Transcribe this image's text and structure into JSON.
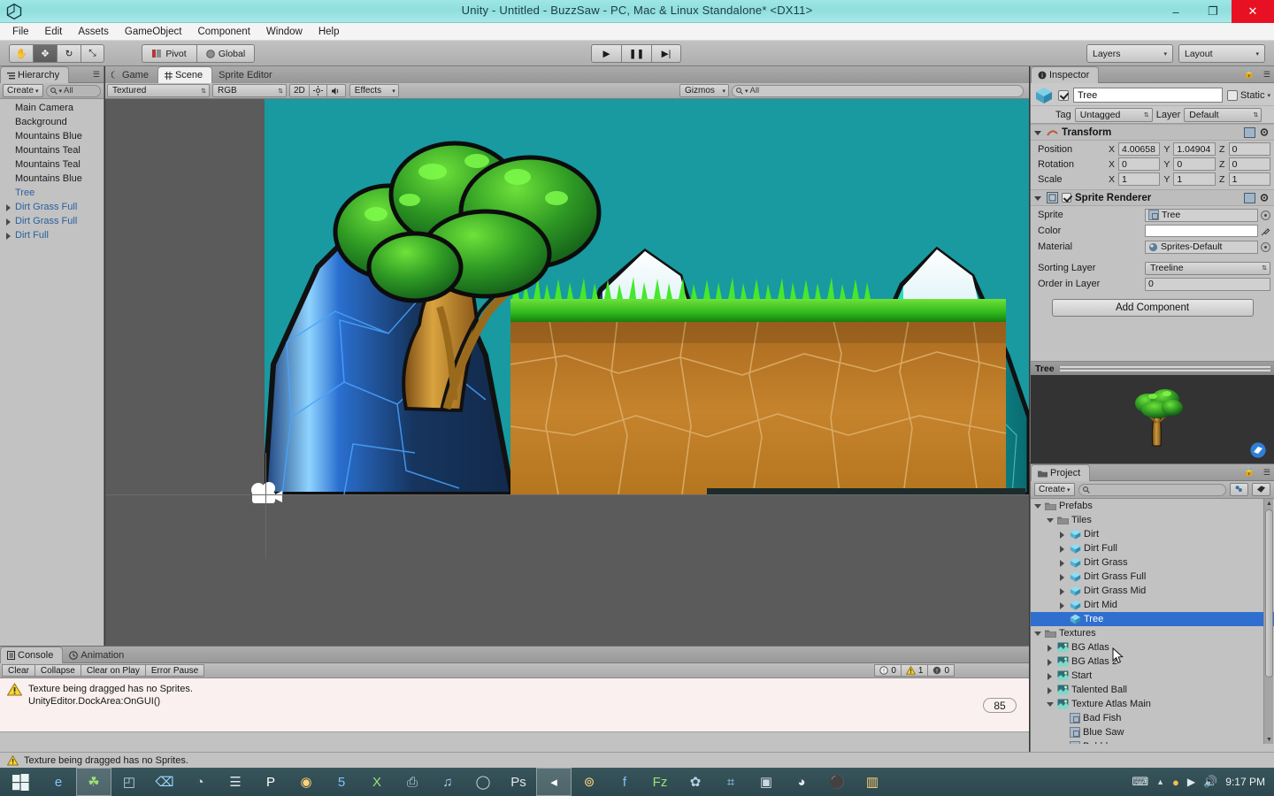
{
  "window": {
    "title": "Unity - Untitled - BuzzSaw - PC, Mac & Linux Standalone* <DX11>",
    "minimize": "–",
    "maximize": "❐",
    "close": "✕",
    "logo_icon": "unity-logo-icon"
  },
  "menubar": {
    "items": [
      "File",
      "Edit",
      "Assets",
      "GameObject",
      "Component",
      "Window",
      "Help"
    ]
  },
  "toolbar": {
    "tools": [
      {
        "name": "hand-tool",
        "glyph": "✋"
      },
      {
        "name": "move-tool",
        "glyph": "✥"
      },
      {
        "name": "rotate-tool",
        "glyph": "↻"
      },
      {
        "name": "scale-tool",
        "glyph": "⤡"
      }
    ],
    "pivot_label": "Pivot",
    "global_label": "Global",
    "play_glyph": "▶",
    "pause_glyph": "❚❚",
    "step_glyph": "▶|",
    "layers_label": "Layers",
    "layout_label": "Layout",
    "caret": "▾"
  },
  "hierarchy": {
    "tab_label": "Hierarchy",
    "create_label": "Create",
    "search_value": "All",
    "search_icon": "search-icon",
    "items": [
      {
        "label": "Main Camera",
        "expandable": false,
        "blue": false
      },
      {
        "label": "Background",
        "expandable": false,
        "blue": false
      },
      {
        "label": "Mountains Blue",
        "expandable": false,
        "blue": false
      },
      {
        "label": "Mountains Teal",
        "expandable": false,
        "blue": false
      },
      {
        "label": "Mountains Teal",
        "expandable": false,
        "blue": false
      },
      {
        "label": "Mountains Blue",
        "expandable": false,
        "blue": false
      },
      {
        "label": "Tree",
        "expandable": false,
        "blue": true
      },
      {
        "label": "Dirt Grass Full",
        "expandable": true,
        "blue": true
      },
      {
        "label": "Dirt Grass Full",
        "expandable": true,
        "blue": true
      },
      {
        "label": "Dirt Full",
        "expandable": true,
        "blue": true
      }
    ]
  },
  "scene": {
    "tabs": [
      {
        "label": "Game",
        "icon": "game-icon",
        "selected": false
      },
      {
        "label": "Scene",
        "icon": "scene-grid-icon",
        "selected": true
      },
      {
        "label": "Sprite Editor",
        "icon": "",
        "selected": false
      }
    ],
    "draw_mode": "Textured",
    "color_mode": "RGB",
    "mode_2d": "2D",
    "lighting_icon": "sun-icon",
    "audio_icon": "speaker-icon",
    "effects_label": "Effects",
    "gizmos_label": "Gizmos",
    "gizmo_search_value": "All",
    "camera_gizmo": "camera-gizmo-icon"
  },
  "inspector": {
    "tab_label": "Inspector",
    "lock_icon": "lock-icon",
    "menu_icon": "options-icon",
    "object_name": "Tree",
    "object_enabled": true,
    "static_label": "Static",
    "tag_label": "Tag",
    "tag_value": "Untagged",
    "layer_label": "Layer",
    "layer_value": "Default",
    "transform": {
      "title": "Transform",
      "rows": [
        {
          "label": "Position",
          "x": "4.00658",
          "y": "1.04904",
          "z": "0"
        },
        {
          "label": "Rotation",
          "x": "0",
          "y": "0",
          "z": "0"
        },
        {
          "label": "Scale",
          "x": "1",
          "y": "1",
          "z": "1"
        }
      ]
    },
    "sprite_renderer": {
      "title": "Sprite Renderer",
      "enabled": true,
      "sprite_label": "Sprite",
      "sprite_value": "Tree",
      "color_label": "Color",
      "color_value": "#FFFFFF",
      "material_label": "Material",
      "material_value": "Sprites-Default",
      "sorting_layer_label": "Sorting Layer",
      "sorting_layer_value": "Treeline",
      "order_in_layer_label": "Order in Layer",
      "order_in_layer_value": "0"
    },
    "add_component_label": "Add Component",
    "preview_title": "Tree",
    "preview_tag_icon": "tag-icon"
  },
  "project": {
    "tab_label": "Project",
    "create_label": "Create",
    "search_value": "",
    "search_icon": "search-icon",
    "favorite_icon": "add-favorite-icon",
    "label_icon": "label-icon",
    "items": [
      {
        "label": "Prefabs",
        "indent": 0,
        "arrow": "open",
        "icon": "folder",
        "selected": false
      },
      {
        "label": "Tiles",
        "indent": 1,
        "arrow": "open",
        "icon": "folder",
        "selected": false
      },
      {
        "label": "Dirt",
        "indent": 2,
        "arrow": "closed",
        "icon": "prefab",
        "selected": false
      },
      {
        "label": "Dirt Full",
        "indent": 2,
        "arrow": "closed",
        "icon": "prefab",
        "selected": false
      },
      {
        "label": "Dirt Grass",
        "indent": 2,
        "arrow": "closed",
        "icon": "prefab",
        "selected": false
      },
      {
        "label": "Dirt Grass Full",
        "indent": 2,
        "arrow": "closed",
        "icon": "prefab",
        "selected": false
      },
      {
        "label": "Dirt Grass Mid",
        "indent": 2,
        "arrow": "closed",
        "icon": "prefab",
        "selected": false
      },
      {
        "label": "Dirt Mid",
        "indent": 2,
        "arrow": "closed",
        "icon": "prefab",
        "selected": false
      },
      {
        "label": "Tree",
        "indent": 2,
        "arrow": "none",
        "icon": "prefab",
        "selected": true
      },
      {
        "label": "Textures",
        "indent": 0,
        "arrow": "open",
        "icon": "folder",
        "selected": false
      },
      {
        "label": "BG Atlas",
        "indent": 1,
        "arrow": "closed",
        "icon": "texture",
        "selected": false
      },
      {
        "label": "BG Atlas 2",
        "indent": 1,
        "arrow": "closed",
        "icon": "texture",
        "selected": false
      },
      {
        "label": "Start",
        "indent": 1,
        "arrow": "closed",
        "icon": "texture",
        "selected": false
      },
      {
        "label": "Talented Ball",
        "indent": 1,
        "arrow": "closed",
        "icon": "texture",
        "selected": false
      },
      {
        "label": "Texture Atlas Main",
        "indent": 1,
        "arrow": "open",
        "icon": "texture",
        "selected": false
      },
      {
        "label": "Bad Fish",
        "indent": 2,
        "arrow": "none",
        "icon": "sprite",
        "selected": false
      },
      {
        "label": "Blue Saw",
        "indent": 2,
        "arrow": "none",
        "icon": "sprite",
        "selected": false
      },
      {
        "label": "Bubbles",
        "indent": 2,
        "arrow": "none",
        "icon": "sprite",
        "selected": false
      }
    ],
    "cursor_icon": "mouse-cursor-icon"
  },
  "console": {
    "tabs": [
      {
        "label": "Console",
        "icon": "console-icon",
        "selected": true
      },
      {
        "label": "Animation",
        "icon": "clock-icon",
        "selected": false
      }
    ],
    "buttons": [
      "Clear",
      "Collapse",
      "Clear on Play",
      "Error Pause"
    ],
    "counters": [
      {
        "icon": "info-icon",
        "count": "0"
      },
      {
        "icon": "warning-icon",
        "count": "1"
      },
      {
        "icon": "error-icon",
        "count": "0"
      }
    ],
    "message_line1": "Texture being dragged has no Sprites.",
    "message_line2": "UnityEditor.DockArea:OnGUI()",
    "message_icon": "warning-icon",
    "badge": "85"
  },
  "statusbar": {
    "icon": "warning-icon",
    "text": "Texture being dragged has no Sprites."
  },
  "taskbar": {
    "start_icon": "windows-start-icon",
    "items": [
      {
        "name": "internet-explorer-icon",
        "glyph": "e",
        "active": false
      },
      {
        "name": "unity-icon",
        "glyph": "☘",
        "active": true
      },
      {
        "name": "visual-studio-icon",
        "glyph": "◰",
        "active": false
      },
      {
        "name": "powershell-icon",
        "glyph": "⌫",
        "active": false
      },
      {
        "name": "steam-icon",
        "glyph": "◔",
        "active": false
      },
      {
        "name": "notes-icon",
        "glyph": "☰",
        "active": false
      },
      {
        "name": "powerpoint-icon",
        "glyph": "P",
        "active": false
      },
      {
        "name": "chrome-icon",
        "glyph": "◉",
        "active": false
      },
      {
        "name": "calculator-icon",
        "glyph": "5",
        "active": false
      },
      {
        "name": "excel-icon",
        "glyph": "X",
        "active": false
      },
      {
        "name": "printer-icon",
        "glyph": "⎙",
        "active": false
      },
      {
        "name": "media-icon",
        "glyph": "♫",
        "active": false
      },
      {
        "name": "oval-app-icon",
        "glyph": "◯",
        "active": false
      },
      {
        "name": "photoshop-icon",
        "glyph": "Ps",
        "active": false
      },
      {
        "name": "volume-app-icon",
        "glyph": "◂",
        "active": true
      },
      {
        "name": "rings-icon",
        "glyph": "⊚",
        "active": false
      },
      {
        "name": "facebook-icon",
        "glyph": "f",
        "active": false
      },
      {
        "name": "filezilla-icon",
        "glyph": "Fz",
        "active": false
      },
      {
        "name": "gimp-icon",
        "glyph": "✿",
        "active": false
      },
      {
        "name": "code-icon",
        "glyph": "⌗",
        "active": false
      },
      {
        "name": "folder-app-icon",
        "glyph": "▣",
        "active": false
      },
      {
        "name": "orange-app-icon",
        "glyph": "◕",
        "active": false
      },
      {
        "name": "skype-icon",
        "glyph": "⚫",
        "active": false
      },
      {
        "name": "window-app-icon",
        "glyph": "▥",
        "active": false
      }
    ],
    "tray": [
      {
        "name": "keyboard-icon",
        "glyph": "⌨"
      },
      {
        "name": "show-hidden-icons-icon",
        "glyph": "▲"
      },
      {
        "name": "shield-icon",
        "glyph": "●"
      },
      {
        "name": "network-icon",
        "glyph": "▶"
      },
      {
        "name": "volume-icon",
        "glyph": "ὐA"
      }
    ],
    "clock": "9:17 PM"
  }
}
